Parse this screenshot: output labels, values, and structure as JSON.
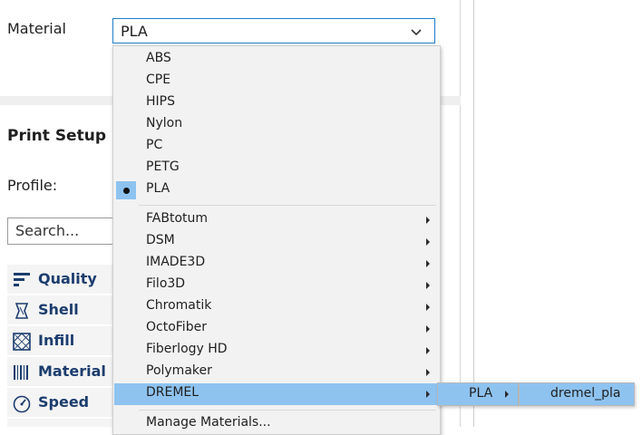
{
  "material_field": {
    "label": "Material",
    "value": "PLA"
  },
  "print_setup": {
    "title": "Print Setup",
    "profile_label": "Profile:",
    "search_placeholder": "Search..."
  },
  "categories": [
    {
      "label": "Quality",
      "icon": "quality-icon"
    },
    {
      "label": "Shell",
      "icon": "shell-icon"
    },
    {
      "label": "Infill",
      "icon": "infill-icon"
    },
    {
      "label": "Material",
      "icon": "material-icon"
    },
    {
      "label": "Speed",
      "icon": "speed-icon"
    }
  ],
  "menu": {
    "generic": [
      "ABS",
      "CPE",
      "HIPS",
      "Nylon",
      "PC",
      "PETG",
      "PLA"
    ],
    "selected": "PLA",
    "brands": [
      "FABtotum",
      "DSM",
      "IMADE3D",
      "Filo3D",
      "Chromatik",
      "OctoFiber",
      "Fiberlogy HD",
      "Polymaker",
      "DREMEL"
    ],
    "highlighted_brand": "DREMEL",
    "manage": "Manage Materials..."
  },
  "submenu": {
    "label": "PLA",
    "item": "dremel_pla"
  },
  "colors": {
    "accent": "#1e7dc8",
    "highlight": "#8ec3f0",
    "category_text": "#1c3d6e"
  }
}
